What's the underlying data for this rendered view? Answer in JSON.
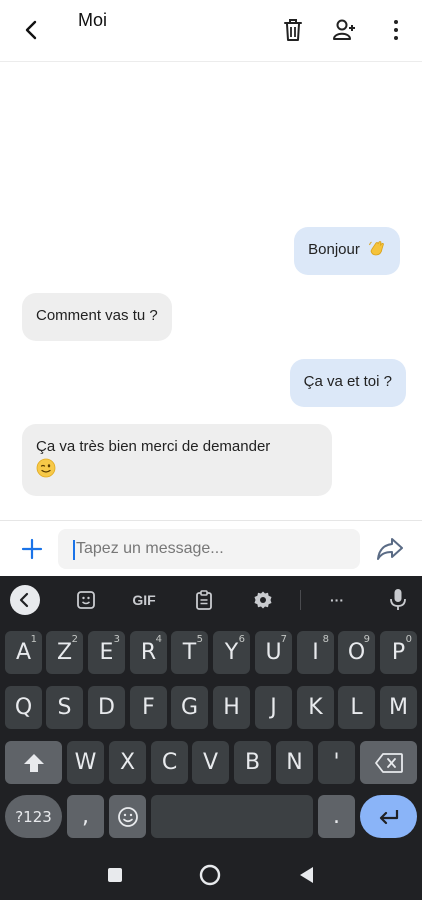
{
  "header": {
    "title": "Moi"
  },
  "messages": [
    {
      "side": "sent",
      "text": "Bonjour",
      "emoji": "waving-hand"
    },
    {
      "side": "received",
      "text": "Comment vas tu ?"
    },
    {
      "side": "sent",
      "text": "Ça va et toi ?"
    },
    {
      "side": "received",
      "text": "Ça va très bien merci de demander",
      "emoji": "winking-face"
    }
  ],
  "composer": {
    "placeholder": "Tapez un message...",
    "value": ""
  },
  "keyboard": {
    "toolbar": {
      "gif_label": "GIF",
      "more_label": "···"
    },
    "rows": [
      {
        "keys": [
          [
            "A",
            "1"
          ],
          [
            "Z",
            "2"
          ],
          [
            "E",
            "3"
          ],
          [
            "R",
            "4"
          ],
          [
            "T",
            "5"
          ],
          [
            "Y",
            "6"
          ],
          [
            "U",
            "7"
          ],
          [
            "I",
            "8"
          ],
          [
            "O",
            "9"
          ],
          [
            "P",
            "0"
          ]
        ]
      },
      {
        "keys": [
          "Q",
          "S",
          "D",
          "F",
          "G",
          "H",
          "J",
          "K",
          "L",
          "M"
        ]
      },
      {
        "keys": [
          "W",
          "X",
          "C",
          "V",
          "B",
          "N",
          "'"
        ]
      }
    ],
    "numbers_label": "?123",
    "comma_label": ",",
    "period_label": "."
  },
  "colors": {
    "sent_bubble": "#dce8f8",
    "received_bubble": "#eeeeee",
    "keyboard_bg": "#202124",
    "key_bg": "#3c4043",
    "accent": "#8ab4f8"
  }
}
